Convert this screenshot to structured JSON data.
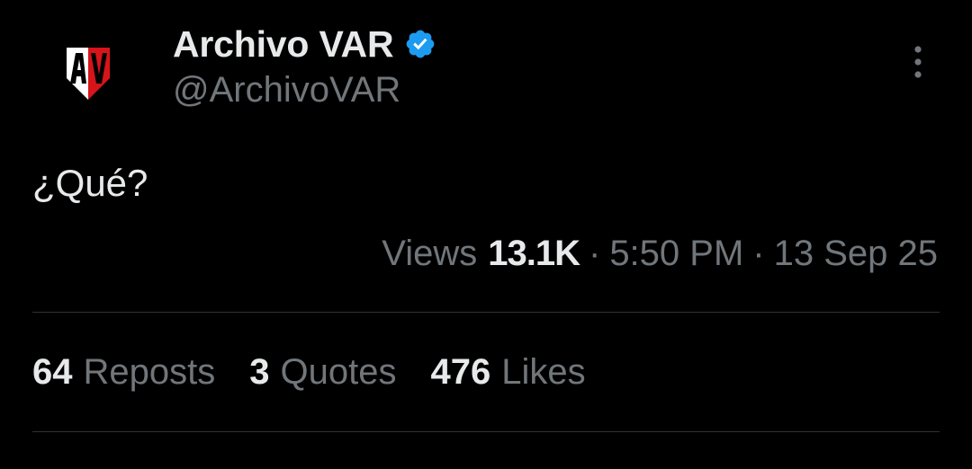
{
  "author": {
    "display_name": "Archivo VAR",
    "handle": "@ArchivoVAR",
    "avatar_icon": "archivo-var-logo",
    "verified": true,
    "verified_color": "#1d9bf0"
  },
  "tweet": {
    "text": "¿Qué?"
  },
  "meta": {
    "views_label": "Views",
    "views_count": "13.1K",
    "separator": "·",
    "time": "5:50 PM",
    "date": "13 Sep 25"
  },
  "stats": {
    "reposts": {
      "count": "64",
      "label": "Reposts"
    },
    "quotes": {
      "count": "3",
      "label": "Quotes"
    },
    "likes": {
      "count": "476",
      "label": "Likes"
    }
  },
  "icons": {
    "more": "more-vertical-icon",
    "verified": "verified-badge-icon"
  },
  "colors": {
    "background": "#000000",
    "primary_text": "#e7e9ea",
    "secondary_text": "#71767b",
    "divider": "#2f3336",
    "logo_red": "#d7141a"
  }
}
